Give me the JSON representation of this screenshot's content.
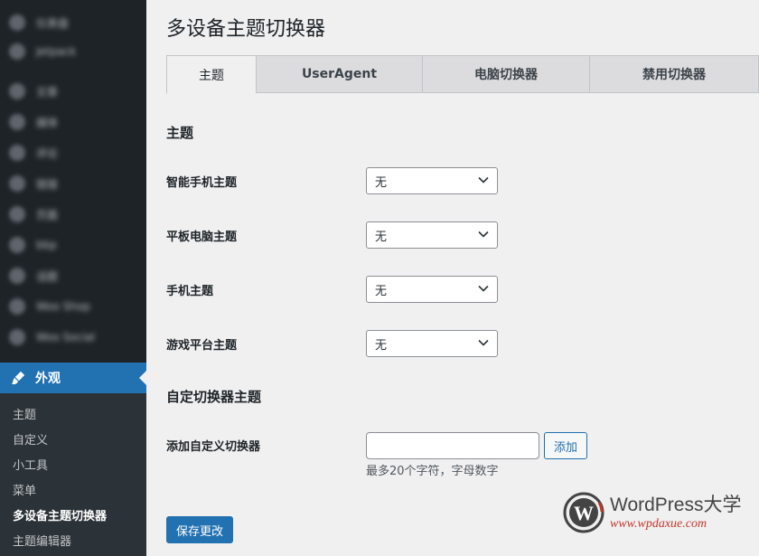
{
  "sidebar": {
    "items": [
      {
        "icon": "dashboard-icon",
        "label": "仪表盘"
      },
      {
        "icon": "jetpack-icon",
        "label": "Jetpack"
      },
      {
        "icon": "pin-icon",
        "label": "文章"
      },
      {
        "icon": "media-icon",
        "label": "媒体"
      },
      {
        "icon": "comments-icon",
        "label": "评论"
      },
      {
        "icon": "link-icon",
        "label": "链接"
      },
      {
        "icon": "pages-icon",
        "label": "页面"
      },
      {
        "icon": "forum-icon",
        "label": "bbp"
      },
      {
        "icon": "topics-icon",
        "label": "话题"
      },
      {
        "icon": "shop-icon",
        "label": "Woo Shop"
      },
      {
        "icon": "social-icon",
        "label": "Woo Social"
      }
    ],
    "current": {
      "icon": "paintbrush-icon",
      "label": "外观"
    },
    "submenu": [
      {
        "label": "主题",
        "active": false
      },
      {
        "label": "自定义",
        "active": false
      },
      {
        "label": "小工具",
        "active": false
      },
      {
        "label": "菜单",
        "active": false
      },
      {
        "label": "多设备主题切换器",
        "active": true
      },
      {
        "label": "主题编辑器",
        "active": false
      }
    ]
  },
  "page": {
    "title": "多设备主题切换器",
    "tabs": [
      {
        "label": "主题",
        "active": true
      },
      {
        "label": "UserAgent",
        "active": false
      },
      {
        "label": "电脑切换器",
        "active": false
      },
      {
        "label": "禁用切换器",
        "active": false
      }
    ],
    "section_themes": "主题",
    "fields": [
      {
        "label": "智能手机主题",
        "value": "无"
      },
      {
        "label": "平板电脑主题",
        "value": "无"
      },
      {
        "label": "手机主题",
        "value": "无"
      },
      {
        "label": "游戏平台主题",
        "value": "无"
      }
    ],
    "section_custom": "自定切换器主题",
    "custom_label": "添加自定义切换器",
    "custom_input_value": "",
    "add_button": "添加",
    "hint": "最多20个字符，字母数字",
    "save_button": "保存更改"
  },
  "watermark": {
    "name": "WordPress大学",
    "url": "www.wpdaxue.com"
  },
  "colors": {
    "sidebar_bg": "#1d2327",
    "accent": "#2271b1",
    "page_bg": "#f0f0f1"
  }
}
